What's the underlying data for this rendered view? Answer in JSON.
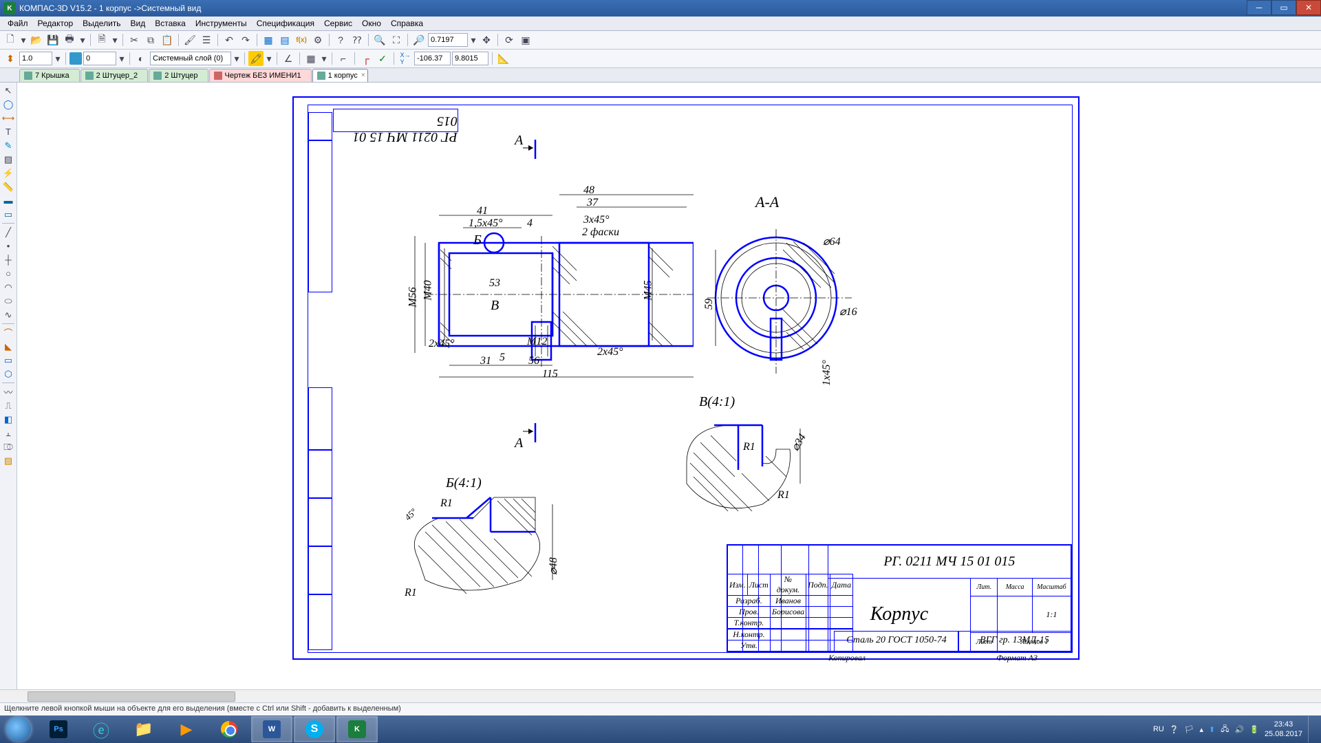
{
  "title": "КОМПАС-3D V15.2  - 1 корпус ->Системный вид",
  "menu": [
    "Файл",
    "Редактор",
    "Выделить",
    "Вид",
    "Вставка",
    "Инструменты",
    "Спецификация",
    "Сервис",
    "Окно",
    "Справка"
  ],
  "zoom_value": "0.7197",
  "coord_x": "-106.37",
  "coord_y": "9.8015",
  "scale_input": "1.0",
  "layer_num": "0",
  "layer_name": "Системный слой (0)",
  "tabs": [
    {
      "label": "7 Крышка",
      "style": "green"
    },
    {
      "label": "2 Штуцер_2",
      "style": "green"
    },
    {
      "label": "2 Штуцер",
      "style": "green"
    },
    {
      "label": "Чертеж БЕЗ ИМЕНИ1",
      "style": "pink"
    },
    {
      "label": "1 корпус",
      "style": "active"
    }
  ],
  "drawing": {
    "upside_code": "РГ 0211 МЧ 15  01  015",
    "section_A": "А",
    "section_AA": "А-А",
    "detail_B": "Б(4:1)",
    "detail_V": "В(4:1)",
    "dims": {
      "d48": "48",
      "d37": "37",
      "d41": "41",
      "ch15": "1,5x45°",
      "d4": "4",
      "ch3": "3x45°",
      "faski": "2 фаски",
      "letB": "Б",
      "d53": "53",
      "letV": "В",
      "m40": "M40",
      "m56": "M56",
      "m45": "M45",
      "m12": "M12",
      "ch2": "2x45°",
      "d5": "5",
      "d31": "31",
      "d56": "56",
      "d115": "115",
      "ch2b": "2x45°",
      "d64": "⌀64",
      "d16": "⌀16",
      "d59": "59",
      "ch1": "1x45°",
      "r1": "R1",
      "r1b": "R1",
      "d48b": "⌀48",
      "a45": "45°",
      "d34": "⌀34"
    },
    "titleblock": {
      "code": "РГ. 0211  МЧ 15  01  015",
      "name": "Корпус",
      "material": "Сталь 20 ГОСТ 1050-74",
      "lit": "Лит.",
      "mass": "Масса",
      "scale": "Масштаб",
      "scale_v": "1:1",
      "sheet": "Лист",
      "sheets": "Листов    1",
      "group": "ВГГ гр. 13МД-15",
      "row1": "Изм.",
      "row1b": "Лист",
      "row1c": "№ докум.",
      "row1d": "Подп.",
      "row1e": "Дата",
      "razrab": "Разраб.",
      "razrab_n": "Иванов",
      "prov": "Пров.",
      "prov_n": "Борисова",
      "tkontr": "Т.контр.",
      "nkontr": "Н.контр.",
      "utv": "Утв.",
      "kopiroval": "Копировал",
      "format": "Формат    A3"
    }
  },
  "status": "Щелкните левой кнопкой мыши на объекте для его выделения (вместе с Ctrl или Shift - добавить к выделенным)",
  "tray": {
    "lang": "RU",
    "time": "23:43",
    "date": "25.08.2017"
  }
}
